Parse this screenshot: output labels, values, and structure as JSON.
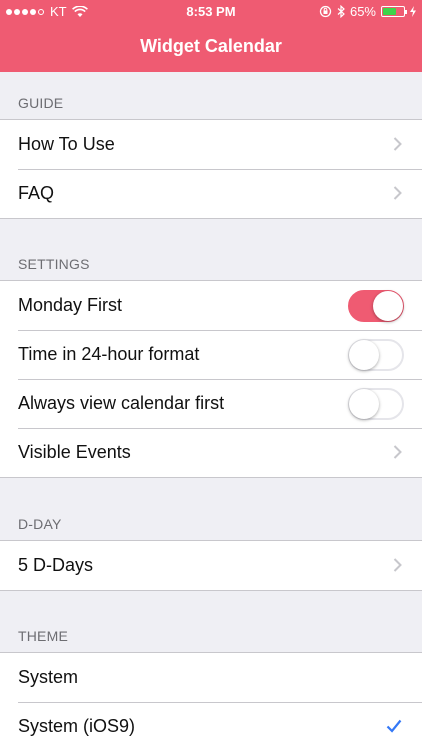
{
  "status_bar": {
    "carrier": "KT",
    "time": "8:53 PM",
    "battery": "65%",
    "battery_level": 0.65
  },
  "nav": {
    "title": "Widget Calendar"
  },
  "colors": {
    "accent": "#ef5b72",
    "check": "#3478f6"
  },
  "sections": {
    "guide": {
      "header": "GUIDE",
      "rows": [
        "How To Use",
        "FAQ"
      ]
    },
    "settings": {
      "header": "SETTINGS",
      "rows": [
        {
          "label": "Monday First",
          "toggle": true
        },
        {
          "label": "Time in 24-hour format",
          "toggle": false
        },
        {
          "label": "Always view calendar first",
          "toggle": false
        },
        {
          "label": "Visible Events"
        }
      ]
    },
    "dday": {
      "header": "D-DAY",
      "rows": [
        "5 D-Days"
      ]
    },
    "theme": {
      "header": "THEME",
      "rows": [
        {
          "label": "System",
          "selected": false
        },
        {
          "label": "System (iOS9)",
          "selected": true
        }
      ]
    }
  }
}
